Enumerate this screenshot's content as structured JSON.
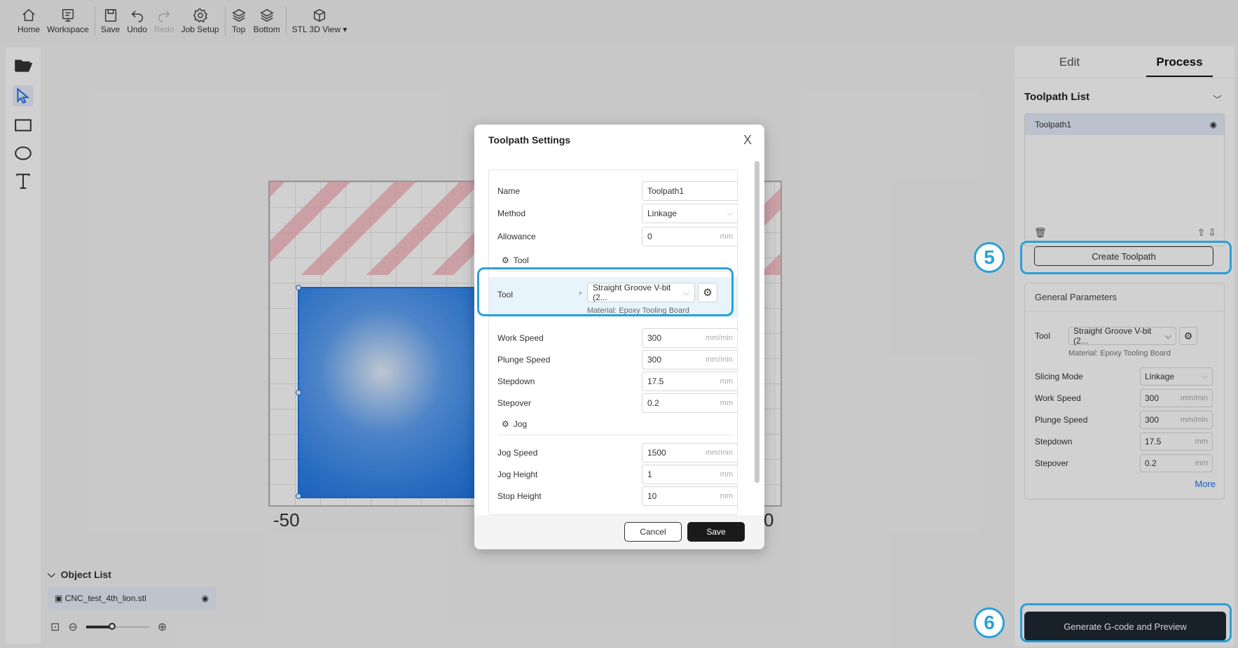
{
  "toolbar": {
    "items": [
      {
        "label": "Home",
        "icon": "home-icon"
      },
      {
        "label": "Workspace",
        "icon": "workspace-icon"
      },
      {
        "label": "Save",
        "icon": "save-icon"
      },
      {
        "label": "Undo",
        "icon": "undo-icon"
      },
      {
        "label": "Redo",
        "icon": "redo-icon",
        "disabled": true
      },
      {
        "label": "Job Setup",
        "icon": "gear-icon"
      },
      {
        "label": "Top",
        "icon": "layers-top-icon"
      },
      {
        "label": "Bottom",
        "icon": "layers-bottom-icon"
      },
      {
        "label": "STL 3D View ▾",
        "icon": "cube-icon"
      }
    ]
  },
  "left_tools": [
    "folder-open-icon",
    "select-arrow-icon",
    "rectangle-icon",
    "ellipse-icon",
    "text-icon"
  ],
  "canvas": {
    "axis_left": "-50",
    "axis_right": "0"
  },
  "object_list": {
    "title": "Object List",
    "items": [
      {
        "name": "CNC_test_4th_lion.stl"
      }
    ]
  },
  "right_panel": {
    "tabs": [
      "Edit",
      "Process"
    ],
    "active_tab": "Process",
    "toolpath_list_title": "Toolpath List",
    "toolpaths": [
      "Toolpath1"
    ],
    "create_button": "Create Toolpath",
    "general_params": {
      "title": "General Parameters",
      "tool_label": "Tool",
      "tool_value": "Straight Groove V-bit (2...",
      "material": "Material: Epoxy Tooling Board",
      "rows": [
        {
          "label": "Slicing Mode",
          "value": "Linkage",
          "unit": "v"
        },
        {
          "label": "Work Speed",
          "value": "300",
          "unit": "mm/min"
        },
        {
          "label": "Plunge Speed",
          "value": "300",
          "unit": "mm/min"
        },
        {
          "label": "Stepdown",
          "value": "17.5",
          "unit": "mm"
        },
        {
          "label": "Stepover",
          "value": "0.2",
          "unit": "mm"
        }
      ],
      "more": "More"
    },
    "generate_button": "Generate G-code and Preview"
  },
  "steps": {
    "five": "5",
    "six": "6"
  },
  "dialog": {
    "title": "Toolpath Settings",
    "close": "X",
    "name_label": "Name",
    "name_value": "Toolpath1",
    "method_label": "Method",
    "method_value": "Linkage",
    "allowance_label": "Allowance",
    "allowance_value": "0",
    "allowance_unit": "mm",
    "tool_section": "Tool",
    "tool_label": "Tool",
    "tool_required": "*",
    "tool_value": "Straight Groove V-bit (2...",
    "tool_material": "Material: Epoxy Tooling Board",
    "work_speed_label": "Work Speed",
    "work_speed_value": "300",
    "work_speed_unit": "mm/min",
    "plunge_speed_label": "Plunge Speed",
    "plunge_speed_value": "300",
    "plunge_speed_unit": "mm/min",
    "stepdown_label": "Stepdown",
    "stepdown_value": "17.5",
    "stepdown_unit": "mm",
    "stepover_label": "Stepover",
    "stepover_value": "0.2",
    "stepover_unit": "mm",
    "jog_section": "Jog",
    "jog_speed_label": "Jog Speed",
    "jog_speed_value": "1500",
    "jog_speed_unit": "mm/min",
    "jog_height_label": "Jog Height",
    "jog_height_value": "1",
    "jog_height_unit": "mm",
    "stop_height_label": "Stop Height",
    "stop_height_value": "10",
    "stop_height_unit": "mm",
    "cancel": "Cancel",
    "save": "Save"
  },
  "colors": {
    "accent": "#1a73e8",
    "highlight": "#2aa0d8",
    "primary_button": "#1e2933"
  }
}
